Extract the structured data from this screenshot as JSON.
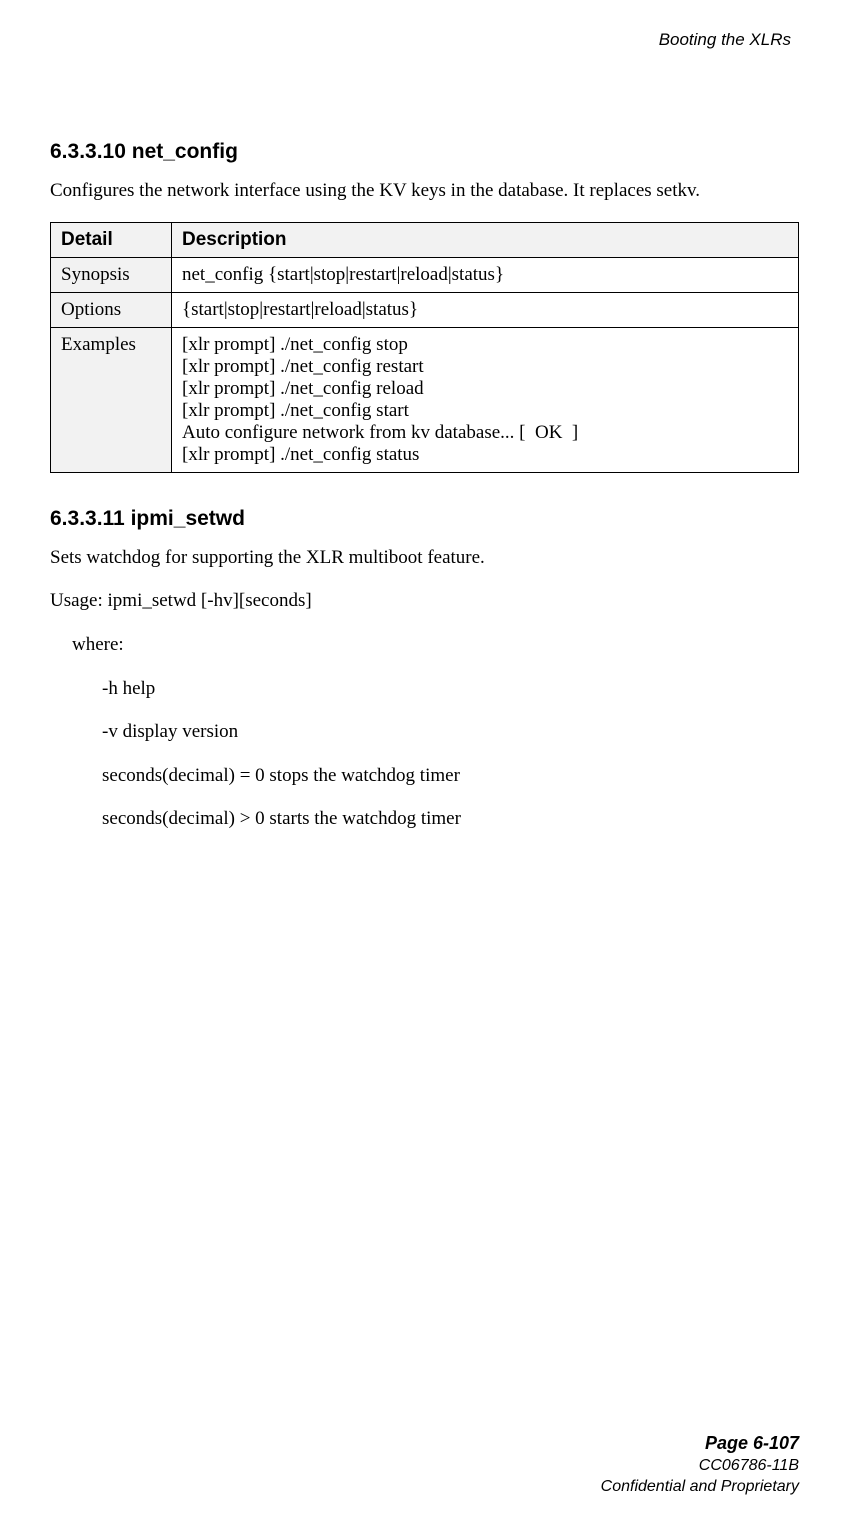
{
  "running_head": "Booting the XLRs",
  "section1": {
    "number": "6.3.3.10",
    "title": "net_config",
    "intro": "Configures the network interface using the KV keys in the database. It replaces setkv.",
    "table": {
      "head": [
        "Detail",
        "Description"
      ],
      "rows": [
        [
          "Synopsis",
          "net_config {start|stop|restart|reload|status}"
        ],
        [
          "Options",
          "{start|stop|restart|reload|status}"
        ],
        [
          "Examples",
          "[xlr prompt] ./net_config stop\n[xlr prompt] ./net_config restart\n[xlr prompt] ./net_config reload\n[xlr prompt] ./net_config start\nAuto configure network from kv database... [  OK  ]\n[xlr prompt] ./net_config status"
        ]
      ]
    }
  },
  "section2": {
    "number": "6.3.3.11",
    "title": "ipmi_setwd",
    "intro": "Sets watchdog for supporting the XLR multiboot feature.",
    "usage": "Usage: ipmi_setwd [-hv][seconds]",
    "where": "where:",
    "opts": [
      "-h help",
      "-v display version",
      "seconds(decimal) = 0 stops the watchdog timer",
      "seconds(decimal) > 0 starts the watchdog timer"
    ]
  },
  "footer": {
    "page": "Page 6-107",
    "doc": "CC06786-11B",
    "conf": "Confidential and Proprietary"
  }
}
